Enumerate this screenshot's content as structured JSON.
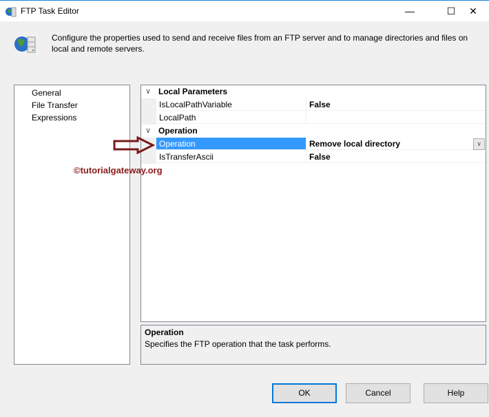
{
  "window": {
    "title": "FTP Task Editor",
    "minimize": "—",
    "maximize": "☐",
    "close": "✕"
  },
  "header": {
    "description": "Configure the properties used to send and receive files from an FTP server and to manage directories and files on local and remote servers."
  },
  "nav": {
    "items": [
      {
        "label": "General"
      },
      {
        "label": "File Transfer"
      },
      {
        "label": "Expressions"
      }
    ]
  },
  "grid": {
    "categories": [
      {
        "label": "Local Parameters",
        "props": [
          {
            "name": "IsLocalPathVariable",
            "value": "False"
          },
          {
            "name": "LocalPath",
            "value": ""
          }
        ]
      },
      {
        "label": "Operation",
        "props": [
          {
            "name": "Operation",
            "value": "Remove local directory"
          },
          {
            "name": "IsTransferAscii",
            "value": "False"
          }
        ]
      }
    ]
  },
  "help": {
    "title": "Operation",
    "text": "Specifies the FTP operation that the task performs."
  },
  "buttons": {
    "ok": "OK",
    "cancel": "Cancel",
    "help": "Help"
  },
  "watermark": "©tutorialgateway.org",
  "colors": {
    "selection": "#3399ff",
    "accent": "#0078d7",
    "watermark": "#8b1a1a"
  }
}
